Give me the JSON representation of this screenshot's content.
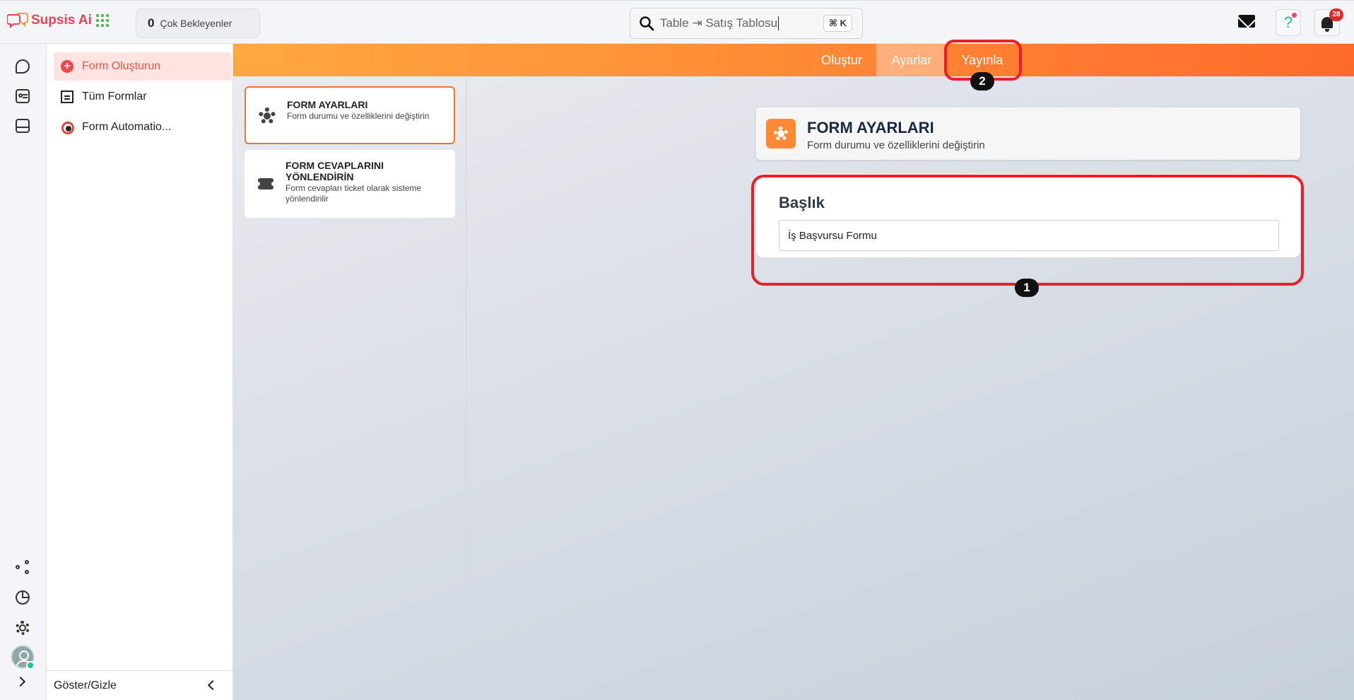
{
  "app": {
    "brand": "Supsis Ai",
    "waiting": {
      "count": "0",
      "label": "Çok Bekleyenler"
    },
    "search": {
      "text": "Table ⇥ Satış Tablosu",
      "shortcut": "⌘ K"
    },
    "notifications": {
      "count": "28"
    }
  },
  "sidebar": {
    "items": [
      {
        "label": "Form Oluşturun",
        "icon": "plus-circle-icon",
        "active": true
      },
      {
        "label": "Tüm Formlar",
        "icon": "forms-list-icon",
        "active": false
      },
      {
        "label": "Form Automatio...",
        "icon": "automation-icon",
        "active": false
      }
    ],
    "footer_label": "Göster/Gizle"
  },
  "tabs": [
    {
      "label": "Oluştur"
    },
    {
      "label": "Ayarlar"
    },
    {
      "label": "Yayınla"
    }
  ],
  "settings_cards": [
    {
      "title": "FORM AYARLARI",
      "subtitle": "Form durumu ve özelliklerini değiştirin",
      "icon": "gear-icon"
    },
    {
      "title": "FORM CEVAPLARINI YÖNLENDİRİN",
      "subtitle": "Form cevapları ticket olarak sisteme yönlendirilir",
      "icon": "ticket-icon"
    }
  ],
  "panel": {
    "title": "FORM AYARLARI",
    "subtitle": "Form durumu ve özelliklerini değiştirin",
    "field_label": "Başlık",
    "field_value": "İş Başvursu Formu"
  },
  "annotations": {
    "marker_1": "1",
    "marker_2": "2"
  },
  "colors": {
    "accent": "#ff8a35",
    "brand": "#e8435a",
    "highlight": "#e9202a"
  }
}
